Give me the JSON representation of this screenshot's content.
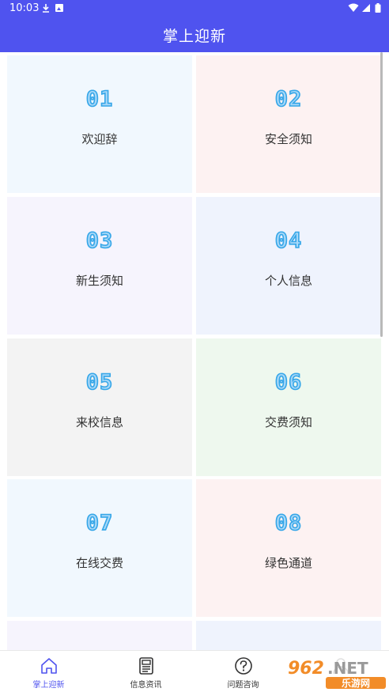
{
  "status_bar": {
    "time": "10:03",
    "left_icons": [
      "download-icon",
      "image-icon"
    ],
    "right_icons": [
      "wifi-icon",
      "signal-icon",
      "battery-icon"
    ]
  },
  "header": {
    "title": "掌上迎新"
  },
  "colors": {
    "primary": "#4f53ef",
    "number_fill": "#a8d8f8",
    "number_stroke": "#35a6e8"
  },
  "tiles": [
    {
      "number": "01",
      "label": "欢迎辞",
      "bg": "#f1f8fe"
    },
    {
      "number": "02",
      "label": "安全须知",
      "bg": "#fdf2f2"
    },
    {
      "number": "03",
      "label": "新生须知",
      "bg": "#f6f4fd"
    },
    {
      "number": "04",
      "label": "个人信息",
      "bg": "#eff3fd"
    },
    {
      "number": "05",
      "label": "来校信息",
      "bg": "#f3f3f3"
    },
    {
      "number": "06",
      "label": "交费须知",
      "bg": "#eef8ee"
    },
    {
      "number": "07",
      "label": "在线交费",
      "bg": "#f1f8fe"
    },
    {
      "number": "08",
      "label": "绿色通道",
      "bg": "#fdf2f2"
    }
  ],
  "partial_tiles": [
    {
      "bg": "#f6f4fd"
    },
    {
      "bg": "#eff3fd"
    }
  ],
  "bottom_nav": [
    {
      "label": "掌上迎新",
      "icon": "home-icon",
      "active": true
    },
    {
      "label": "信息资讯",
      "icon": "news-icon",
      "active": false
    },
    {
      "label": "问题咨询",
      "icon": "question-icon",
      "active": false
    },
    {
      "label": "",
      "icon": "profile-icon",
      "active": false
    }
  ],
  "watermark": {
    "brand": "962",
    "suffix": ".NET",
    "site": "乐游网"
  }
}
